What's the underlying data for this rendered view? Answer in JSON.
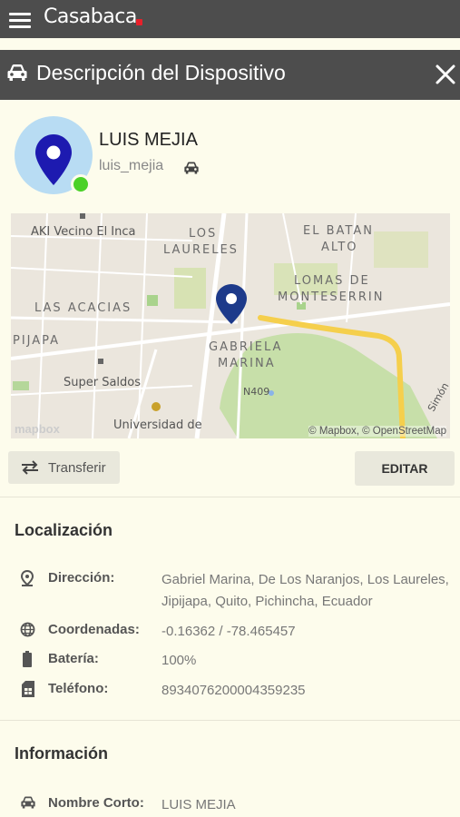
{
  "app": {
    "brand": "Casabaca"
  },
  "header": {
    "title": "Descripción del Dispositivo"
  },
  "profile": {
    "name": "LUIS MEJIA",
    "username": "luis_mejia",
    "status": "online"
  },
  "map": {
    "labels": {
      "aki": "AKI Vecino El Inca",
      "los": "LOS",
      "laureles": "LAURELES",
      "batan": "EL BATAN",
      "alto": "ALTO",
      "lomas": "LOMAS DE",
      "monteserrin": "MONTESERRIN",
      "acacias": "LAS ACACIAS",
      "pijapa": "PIJAPA",
      "gabriela": "GABRIELA",
      "marina": "MARINA",
      "super": "Super Saldos",
      "road": "N409",
      "universidad": "Universidad de",
      "simon": "Simón"
    },
    "logo": "mapbox",
    "attribution": "© Mapbox, © OpenStreetMap"
  },
  "actions": {
    "transfer": "Transferir",
    "edit": "EDITAR"
  },
  "location": {
    "title": "Localización",
    "rows": [
      {
        "icon": "pin-icon",
        "key": "Dirección:",
        "value": "Gabriel Marina, De Los Naranjos, Los Laureles, Jipijapa, Quito, Pichincha, Ecuador"
      },
      {
        "icon": "globe-icon",
        "key": "Coordenadas:",
        "value": "-0.16362 / -78.465457"
      },
      {
        "icon": "battery-icon",
        "key": "Batería:",
        "value": "100%"
      },
      {
        "icon": "sim-card-icon",
        "key": "Teléfono:",
        "value": "8934076200004359235"
      }
    ]
  },
  "information": {
    "title": "Información",
    "rows": [
      {
        "icon": "car-icon",
        "key": "Nombre Corto:",
        "value": "LUIS MEJIA"
      }
    ]
  },
  "colors": {
    "header": "#4d4d4d",
    "background": "#fdfcec",
    "pin": "#1d3a8a",
    "online": "#4bd128",
    "brand_dot": "#e8202a"
  }
}
